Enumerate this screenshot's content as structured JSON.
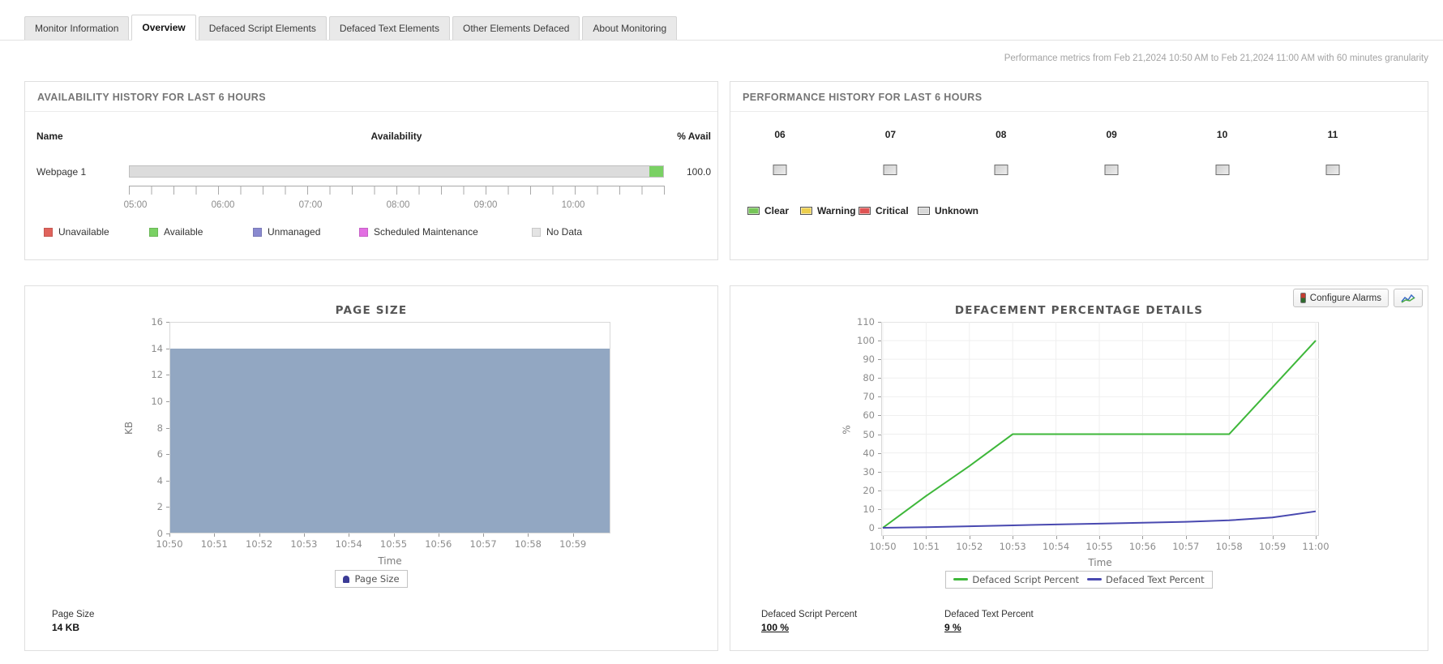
{
  "tabs": [
    {
      "label": "Monitor Information",
      "active": false
    },
    {
      "label": "Overview",
      "active": true
    },
    {
      "label": "Defaced Script Elements",
      "active": false
    },
    {
      "label": "Defaced Text Elements",
      "active": false
    },
    {
      "label": "Other Elements Defaced",
      "active": false
    },
    {
      "label": "About Monitoring",
      "active": false
    }
  ],
  "metrics_note": "Performance metrics from Feb 21,2024 10:50 AM to Feb 21,2024 11:00 AM with 60 minutes granularity",
  "availability": {
    "title": "AVAILABILITY HISTORY FOR LAST 6 HOURS",
    "columns": [
      "Name",
      "Availability",
      "% Avail"
    ],
    "row": {
      "name": "Webpage 1",
      "percent": "100.0",
      "bar_segments": [
        {
          "status": "No Data",
          "pct": 97.4,
          "color": "#dcdcdc"
        },
        {
          "status": "Available",
          "pct": 2.6,
          "color": "#7ad164"
        }
      ]
    },
    "time_ticks": [
      "05:00",
      "06:00",
      "07:00",
      "08:00",
      "09:00",
      "10:00"
    ],
    "legend": [
      {
        "label": "Unavailable",
        "color": "#e0635c"
      },
      {
        "label": "Available",
        "color": "#7ad164"
      },
      {
        "label": "Unmanaged",
        "color": "#8a8ad0"
      },
      {
        "label": "Scheduled Maintenance",
        "color": "#e26fe2"
      },
      {
        "label": "No Data",
        "color": "#e4e4e4"
      }
    ]
  },
  "performance": {
    "title": "PERFORMANCE HISTORY FOR LAST 6 HOURS",
    "hours": [
      "06",
      "07",
      "08",
      "09",
      "10",
      "11"
    ],
    "hour_status": [
      "Unknown",
      "Unknown",
      "Unknown",
      "Unknown",
      "Unknown",
      "Unknown"
    ],
    "legend": [
      {
        "label": "Clear",
        "color": "#76c558"
      },
      {
        "label": "Warning",
        "color": "#ecce4d"
      },
      {
        "label": "Critical",
        "color": "#df5353"
      },
      {
        "label": "Unknown",
        "color": "#d8d8d8"
      }
    ]
  },
  "page_size_panel": {
    "legend_label": "Page Size",
    "footer_label": "Page Size",
    "footer_value": "14 KB"
  },
  "defacement_panel": {
    "configure_alarms_label": "Configure Alarms",
    "footers": [
      {
        "label": "Defaced Script Percent",
        "value": "100 %"
      },
      {
        "label": "Defaced Text Percent",
        "value": "9 %"
      }
    ]
  },
  "chart_data": [
    {
      "type": "area",
      "title": "PAGE SIZE",
      "xlabel": "Time",
      "ylabel": "KB",
      "ylim": [
        0,
        16
      ],
      "ytick_step": 2,
      "grid": false,
      "legend_position": "bottom",
      "x": [
        "10:50",
        "10:51",
        "10:52",
        "10:53",
        "10:54",
        "10:55",
        "10:56",
        "10:57",
        "10:58",
        "10:59"
      ],
      "series": [
        {
          "name": "Page Size",
          "color": "#92a7c2",
          "values": [
            14,
            14,
            14,
            14,
            14,
            14,
            14,
            14,
            14,
            14
          ]
        }
      ]
    },
    {
      "type": "line",
      "title": "DEFACEMENT PERCENTAGE DETAILS",
      "xlabel": "Time",
      "ylabel": "%",
      "ylim": [
        0,
        110
      ],
      "ytick_step": 10,
      "grid": true,
      "legend_position": "bottom",
      "x": [
        "10:50",
        "10:51",
        "10:52",
        "10:53",
        "10:54",
        "10:55",
        "10:56",
        "10:57",
        "10:58",
        "10:59",
        "11:00"
      ],
      "series": [
        {
          "name": "Defaced Script Percent",
          "color": "#3eb73a",
          "values": [
            0,
            17,
            33,
            50,
            50,
            50,
            50,
            50,
            50,
            75,
            100
          ]
        },
        {
          "name": "Defaced Text Percent",
          "color": "#4949b0",
          "values": [
            0,
            0.3,
            0.8,
            1.3,
            1.8,
            2.2,
            2.7,
            3.2,
            4,
            5.5,
            8.8
          ]
        }
      ]
    }
  ]
}
